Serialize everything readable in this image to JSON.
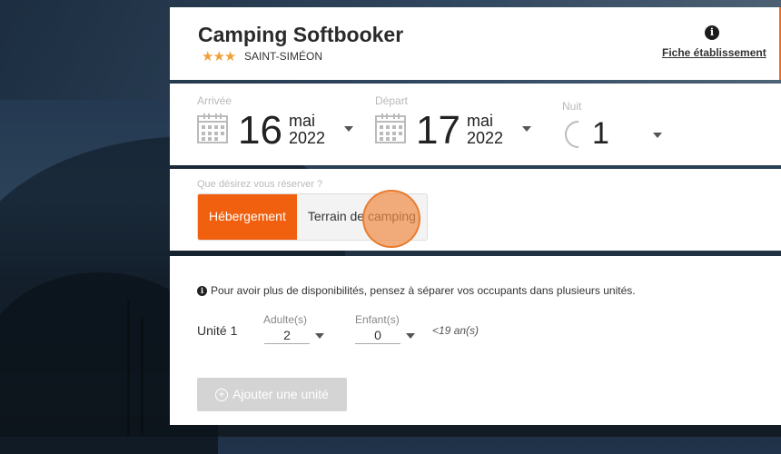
{
  "header": {
    "title": "Camping Softbooker",
    "stars": "★★★",
    "location": "SAINT-SIMÉON",
    "info_icon": "i",
    "fiche_link": "Fiche établissement"
  },
  "dates": {
    "arrival": {
      "label": "Arrivée",
      "day": "16",
      "month": "mai",
      "year": "2022"
    },
    "departure": {
      "label": "Départ",
      "day": "17",
      "month": "mai",
      "year": "2022"
    },
    "nights": {
      "label": "Nuit",
      "value": "1"
    }
  },
  "booking_type": {
    "question": "Que désirez vous réserver ?",
    "options": [
      "Hébergement",
      "Terrain de camping"
    ],
    "selected": "Hébergement"
  },
  "units": {
    "notice": "Pour avoir plus de disponibilités, pensez à séparer vos occupants dans plusieurs unités.",
    "unit_label": "Unité 1",
    "adults_label": "Adulte(s)",
    "adults_value": "2",
    "children_label": "Enfant(s)",
    "children_value": "0",
    "age_note": "<19 an(s)",
    "add_button": "Ajouter une unité"
  },
  "colors": {
    "accent": "#f0600f",
    "stars": "#f0a13a"
  }
}
